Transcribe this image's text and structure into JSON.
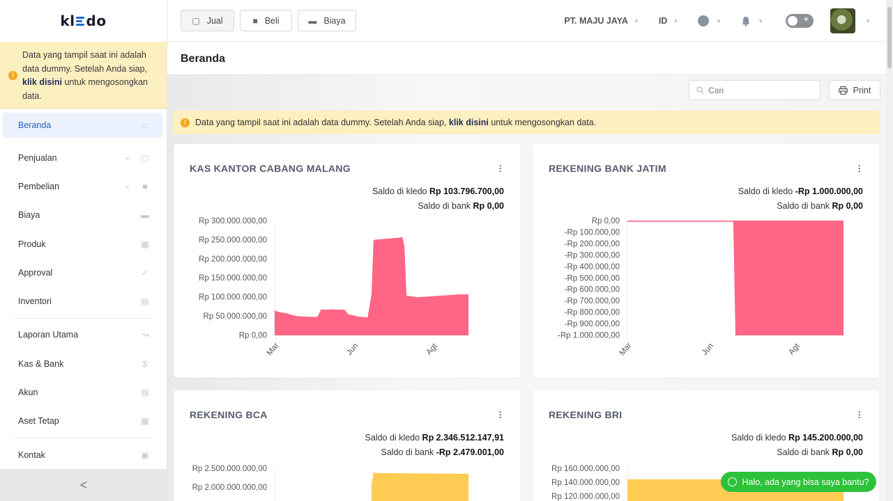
{
  "app": {
    "logo": "kledo"
  },
  "sidebar": {
    "notice": {
      "text1": "Data yang tampil saat ini adalah data dummy. Setelah Anda siap,",
      "link": "klik disini",
      "text2": "untuk mengosongkan data."
    },
    "items": [
      {
        "label": "Beranda",
        "icon": "home-icon"
      },
      {
        "label": "Penjualan",
        "icon": "basket-icon"
      },
      {
        "label": "Pembelian",
        "icon": "bag-icon"
      },
      {
        "label": "Biaya",
        "icon": "card-icon"
      },
      {
        "label": "Produk",
        "icon": "box-icon"
      },
      {
        "label": "Approval",
        "icon": "check-icon"
      },
      {
        "label": "Inventori",
        "icon": "briefcase-icon"
      },
      {
        "label": "Laporan Utama",
        "icon": "chart-icon"
      },
      {
        "label": "Kas & Bank",
        "icon": "dollar-icon"
      },
      {
        "label": "Akun",
        "icon": "list-icon"
      },
      {
        "label": "Aset Tetap",
        "icon": "building-icon"
      },
      {
        "label": "Kontak",
        "icon": "contact-card-icon"
      }
    ],
    "collapse": "<"
  },
  "toolbar": {
    "jual": "Jual",
    "beli": "Beli",
    "biaya": "Biaya",
    "company": "PT. MAJU JAYA",
    "lang": "ID"
  },
  "page": {
    "title": "Beranda"
  },
  "search": {
    "placeholder": "Cari"
  },
  "print_label": "Print",
  "notice": {
    "text1": "Data yang tampil saat ini adalah data dummy. Setelah Anda siap,",
    "link": "klik disini",
    "text2": "untuk mengosongkan data."
  },
  "colors": {
    "pink": "#ff6585",
    "yellow": "#ffcb52",
    "accent": "#1f5fbf",
    "whatsapp": "#2ec13a"
  },
  "chart_data": [
    {
      "type": "area",
      "title": "KAS KANTOR CABANG MALANG",
      "saldo_kledo_label": "Saldo di kledo",
      "saldo_kledo": "Rp 103.796.700,00",
      "saldo_bank_label": "Saldo di bank",
      "saldo_bank": "Rp 0,00",
      "x_ticks": [
        "Mar",
        "Jun",
        "Agt"
      ],
      "y_ticks": [
        "Rp 300.000.000,00",
        "Rp 250.000.000,00",
        "Rp 200.000.000,00",
        "Rp 150.000.000,00",
        "Rp 100.000.000,00",
        "Rp 50.000.000,00",
        "Rp 0,00"
      ],
      "ylim": [
        0,
        300000000
      ],
      "color": "#ff6585",
      "x": [
        0.0,
        0.03,
        0.06,
        0.1,
        0.12,
        0.22,
        0.24,
        0.27,
        0.29,
        0.36,
        0.38,
        0.41,
        0.43,
        0.48,
        0.5,
        0.51,
        0.52,
        0.65,
        0.66,
        0.67,
        0.68,
        0.72,
        0.73,
        0.75,
        0.95,
        1.0
      ],
      "values": [
        65000000,
        60000000,
        58000000,
        52000000,
        50000000,
        48000000,
        68000000,
        67000000,
        68000000,
        67000000,
        55000000,
        52000000,
        49000000,
        47000000,
        108000000,
        248000000,
        250000000,
        256000000,
        255000000,
        230000000,
        104000000,
        101000000,
        100000000,
        100000000,
        107000000,
        107000000
      ]
    },
    {
      "type": "area",
      "title": "REKENING BANK JATIM",
      "saldo_kledo_label": "Saldo di kledo",
      "saldo_kledo": "-Rp 1.000.000,00",
      "saldo_bank_label": "Saldo di bank",
      "saldo_bank": "Rp 0,00",
      "x_ticks": [
        "Mar",
        "Jun",
        "Agt"
      ],
      "y_ticks": [
        "Rp 0,00",
        "-Rp 100.000,00",
        "-Rp 200.000,00",
        "-Rp 300.000,00",
        "-Rp 400.000,00",
        "-Rp 500.000,00",
        "-Rp 600.000,00",
        "-Rp 700.000,00",
        "-Rp 800.000,00",
        "-Rp 900.000,00",
        "-Rp 1.000.000,00"
      ],
      "ylim": [
        -1000000,
        0
      ],
      "color": "#ff6585",
      "x": [
        0.0,
        0.49,
        0.5,
        1.0
      ],
      "values": [
        -10000,
        -10000,
        -1000000,
        -1000000
      ]
    },
    {
      "type": "area",
      "title": "REKENING BCA",
      "saldo_kledo_label": "Saldo di kledo",
      "saldo_kledo": "Rp 2.346.512.147,91",
      "saldo_bank_label": "Saldo di bank",
      "saldo_bank": "-Rp 2.479.001,00",
      "y_ticks": [
        "Rp 2.500.000.000,00",
        "Rp 2.000.000.000,00"
      ],
      "color": "#ffcb52",
      "x": [
        0.5,
        0.51,
        0.52,
        1.0
      ],
      "values": [
        2200000000,
        2480000000,
        2460000000,
        2440000000
      ]
    },
    {
      "type": "area",
      "title": "REKENING BRI",
      "saldo_kledo_label": "Saldo di kledo",
      "saldo_kledo": "Rp 145.200.000,00",
      "saldo_bank_label": "Saldo di bank",
      "saldo_bank": "Rp 0,00",
      "y_ticks": [
        "Rp 160.000.000,00",
        "Rp 140.000.000,00",
        "Rp 120.000.000,00"
      ],
      "color": "#ffcb52",
      "x": [
        0.0,
        1.0
      ],
      "values": [
        145200000,
        145200000
      ]
    }
  ],
  "chat": {
    "label": "Halo, ada yang bisa saya bantu?"
  }
}
